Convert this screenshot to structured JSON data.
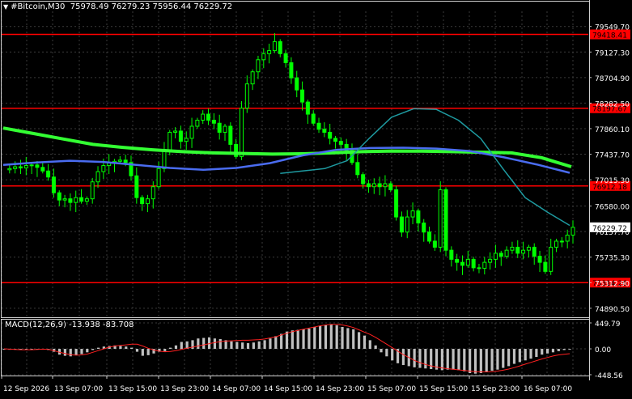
{
  "header": {
    "symbol": "#Bitcoin,M30",
    "ohlc": "75978.49 76279.23 75956.44 76229.72"
  },
  "indicator": {
    "title": "MACD(12,26,9) -13.938 -83.708"
  },
  "colors": {
    "background": "#000000",
    "grid": "#3a3a3a",
    "candle": "#00ff00",
    "level_line": "#ff0000",
    "ma_slow": "#33ff33",
    "ma_mid": "#4a6cf0",
    "ma_fast": "#1e9aa0",
    "macd_hist": "#c0c0c0",
    "macd_signal": "#ff2020",
    "label_bg": "#ff0000"
  },
  "chart_data": {
    "type": "candlestick",
    "price_axis": {
      "ticks": [
        "79549.70",
        "79127.30",
        "78704.90",
        "78282.50",
        "77860.10",
        "77437.70",
        "77015.30",
        "76580.00",
        "76157.70",
        "75735.30",
        "75312.90",
        "74890.50"
      ],
      "current_price": "76229.72",
      "ylim": [
        74755,
        79800
      ]
    },
    "levels": [
      {
        "label": "79418.41",
        "value": 79418.41
      },
      {
        "label": "78197.67",
        "value": 78197.67
      },
      {
        "label": "76912.18",
        "value": 76912.18
      },
      {
        "label": "75314.26",
        "value": 75314.26
      }
    ],
    "time_axis": [
      "12 Sep 2026",
      "13 Sep 07:00",
      "13 Sep 15:00",
      "13 Sep 23:00",
      "14 Sep 07:00",
      "14 Sep 15:00",
      "14 Sep 23:00",
      "15 Sep 07:00",
      "15 Sep 15:00",
      "15 Sep 23:00",
      "16 Sep 07:00"
    ],
    "price_path": [
      77180,
      77200,
      77230,
      77210,
      77250,
      77260,
      77220,
      77160,
      77060,
      76800,
      76680,
      76700,
      76640,
      76720,
      76660,
      76700,
      76980,
      77150,
      77250,
      77300,
      77320,
      77340,
      77300,
      77080,
      76720,
      76620,
      76700,
      76900,
      77200,
      77500,
      77800,
      77820,
      77650,
      77700,
      77900,
      78000,
      78100,
      78000,
      77950,
      77800,
      77900,
      77600,
      77400,
      78200,
      78600,
      78800,
      79000,
      79100,
      79150,
      79300,
      79100,
      78950,
      78700,
      78500,
      78300,
      78100,
      77950,
      77850,
      77800,
      77700,
      77650,
      77600,
      77500,
      77300,
      77100,
      76950,
      76900,
      76950,
      76900,
      76950,
      76850,
      76400,
      76150,
      76400,
      76500,
      76300,
      76150,
      76000,
      75900,
      76850,
      75850,
      75700,
      75650,
      75600,
      75700,
      75560,
      75550,
      75650,
      75700,
      75800,
      75750,
      75850,
      75900,
      75800,
      75850,
      75900,
      75750,
      75650,
      75500,
      75900,
      76000,
      76000,
      76100,
      76229
    ],
    "ma_slow": [
      77870,
      77780,
      77690,
      77600,
      77550,
      77510,
      77480,
      77460,
      77450,
      77440,
      77445,
      77460,
      77480,
      77490,
      77487,
      77480,
      77470,
      77460,
      77380,
      77230
    ],
    "ma_mid": [
      77260,
      77300,
      77330,
      77310,
      77260,
      77210,
      77180,
      77210,
      77290,
      77420,
      77510,
      77540,
      77545,
      77530,
      77490,
      77390,
      77270,
      77130
    ],
    "ma_fast_start_index": 10,
    "ma_fast": [
      77120,
      77160,
      77200,
      77330,
      77700,
      78050,
      78190,
      78180,
      78000,
      77700,
      77200,
      76720,
      76480,
      76260
    ],
    "macd": {
      "ylim": [
        -448.56,
        449.79
      ],
      "ticks": [
        "449.79",
        "0.00",
        "-448.56"
      ],
      "histogram": [
        -15,
        -15,
        -15,
        -10,
        -10,
        -10,
        0,
        -5,
        -20,
        -50,
        -100,
        -120,
        -130,
        -110,
        -90,
        -60,
        -20,
        20,
        40,
        50,
        60,
        50,
        40,
        20,
        -50,
        -120,
        -110,
        -80,
        -50,
        -40,
        20,
        60,
        120,
        130,
        150,
        180,
        190,
        200,
        180,
        170,
        150,
        130,
        120,
        110,
        100,
        110,
        130,
        150,
        180,
        220,
        260,
        300,
        320,
        330,
        340,
        350,
        380,
        400,
        410,
        420,
        410,
        380,
        360,
        340,
        290,
        230,
        150,
        60,
        -60,
        -130,
        -200,
        -250,
        -280,
        -300,
        -320,
        -330,
        -340,
        -350,
        -360,
        -370,
        -360,
        -360,
        -370,
        -390,
        -420,
        -430,
        -420,
        -400,
        -380,
        -360,
        -330,
        -300,
        -260,
        -230,
        -200,
        -170,
        -140,
        -100,
        -80,
        -60,
        -40,
        -20,
        -14
      ],
      "signal": [
        0,
        -5,
        -10,
        -15,
        -15,
        -15,
        -10,
        -5,
        -10,
        -30,
        -60,
        -80,
        -100,
        -110,
        -105,
        -90,
        -60,
        -30,
        0,
        30,
        50,
        60,
        70,
        80,
        80,
        50,
        10,
        -20,
        -40,
        -50,
        -45,
        -30,
        -10,
        10,
        30,
        50,
        70,
        90,
        110,
        125,
        135,
        140,
        145,
        150,
        150,
        155,
        160,
        170,
        190,
        210,
        240,
        270,
        300,
        320,
        340,
        360,
        380,
        400,
        415,
        425,
        425,
        415,
        395,
        370,
        330,
        290,
        250,
        200,
        140,
        80,
        20,
        -40,
        -100,
        -150,
        -200,
        -240,
        -270,
        -295,
        -315,
        -330,
        -345,
        -355,
        -365,
        -375,
        -385,
        -395,
        -400,
        -400,
        -395,
        -385,
        -370,
        -350,
        -325,
        -295,
        -265,
        -235,
        -205,
        -175,
        -150,
        -125,
        -105,
        -95,
        -84
      ]
    }
  }
}
